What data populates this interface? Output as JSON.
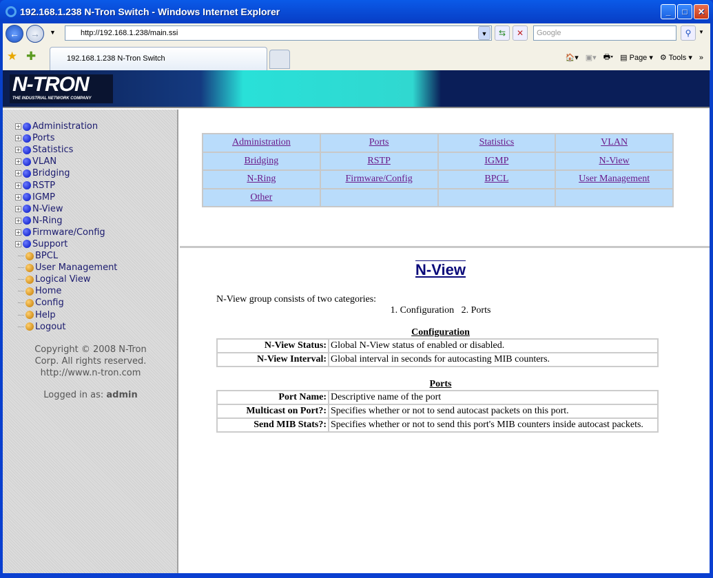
{
  "window": {
    "title": "192.168.1.238 N-Tron Switch - Windows Internet Explorer"
  },
  "browser": {
    "url": "http://192.168.1.238/main.ssi",
    "search_placeholder": "Google",
    "tab_label": "192.168.1.238 N-Tron Switch",
    "page_menu": "Page",
    "tools_menu": "Tools"
  },
  "banner": {
    "logo": "N-TRON",
    "tagline": "THE INDUSTRIAL NETWORK COMPANY"
  },
  "sidebar": {
    "folders": [
      "Administration",
      "Ports",
      "Statistics",
      "VLAN",
      "Bridging",
      "RSTP",
      "IGMP",
      "N-View",
      "N-Ring",
      "Firmware/Config",
      "Support"
    ],
    "links": [
      "BPCL",
      "User Management",
      "Logical View",
      "Home",
      "Config",
      "Help",
      "Logout"
    ],
    "copyright": [
      "Copyright © 2008 N-Tron",
      "Corp. All rights reserved.",
      "http://www.n-tron.com"
    ],
    "logged_in_label": "Logged in as:",
    "logged_in_user": "admin"
  },
  "nav_table": [
    [
      "Administration",
      "Ports",
      "Statistics",
      "VLAN"
    ],
    [
      "Bridging",
      "RSTP",
      "IGMP",
      "N-View"
    ],
    [
      "N-Ring",
      "Firmware/Config",
      "BPCL",
      "User Management"
    ],
    [
      "Other",
      "",
      "",
      ""
    ]
  ],
  "content": {
    "title": "N-View",
    "intro": "N-View group consists of two categories:",
    "categories": "1. Configuration   2. Ports",
    "sections": [
      {
        "heading": "Configuration",
        "rows": [
          [
            "N-View Status:",
            "Global N-View status of enabled or disabled."
          ],
          [
            "N-View Interval:",
            "Global interval in seconds for autocasting MIB counters."
          ]
        ]
      },
      {
        "heading": "Ports",
        "rows": [
          [
            "Port Name:",
            "Descriptive name of the port"
          ],
          [
            "Multicast on Port?:",
            "Specifies whether or not to send autocast packets on this port."
          ],
          [
            "Send MIB Stats?:",
            "Specifies whether or not to send this port's MIB counters inside autocast packets."
          ]
        ]
      }
    ]
  }
}
